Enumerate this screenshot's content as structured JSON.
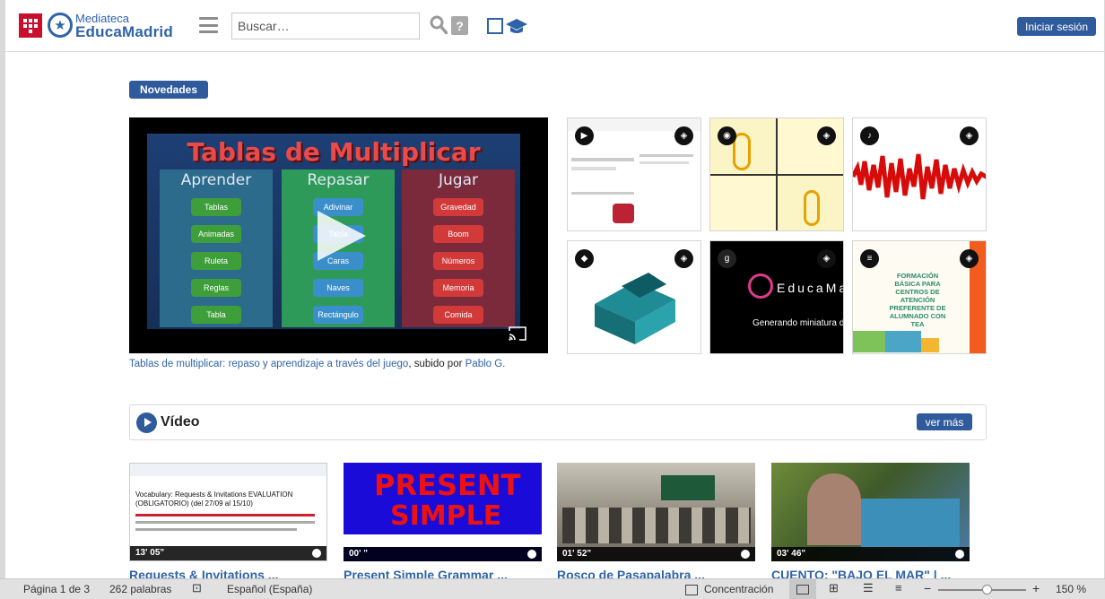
{
  "header": {
    "logo_small": "Mediateca",
    "logo_big": "EducaMadrid",
    "search_placeholder": "Buscar…",
    "help_label": "?",
    "login_label": "Iniciar sesión"
  },
  "novedades": {
    "badge": "Novedades",
    "featured": {
      "board_title": "Tablas de Multiplicar",
      "columns": [
        {
          "header": "Aprender",
          "chips": [
            "Tablas",
            "Animadas",
            "Ruleta",
            "Reglas",
            "Tabla"
          ]
        },
        {
          "header": "Repasar",
          "chips": [
            "Adivinar",
            "Tabla",
            "Caras",
            "Naves",
            "Rectángulo"
          ]
        },
        {
          "header": "Jugar",
          "chips": [
            "Gravedad",
            "Boom",
            "Números",
            "Memoria",
            "Comida"
          ]
        }
      ],
      "caption_link": "Tablas de multiplicar: repaso y aprendizaje a través del juego",
      "caption_mid": ", subido por ",
      "caption_author": "Pablo G."
    },
    "tiles": [
      {
        "type_icon": "play-icon",
        "glyph": "▶"
      },
      {
        "type_icon": "camera-icon",
        "glyph": "◉"
      },
      {
        "type_icon": "audio-icon",
        "glyph": "♪"
      },
      {
        "type_icon": "cube-icon",
        "glyph": "◆"
      },
      {
        "type_icon": "g-icon",
        "glyph": "g",
        "brand_text": "EducaMa",
        "status_text": "Generando miniatura de"
      },
      {
        "type_icon": "document-icon",
        "glyph": "≡",
        "doc_text": "FORMACIÓN BÁSICA PARA CENTROS DE ATENCIÓN PREFERENTE DE ALUMNADO CON TEA"
      }
    ]
  },
  "video_section": {
    "title": "Vídeo",
    "more_label": "ver más",
    "items": [
      {
        "duration": "13' 05\"",
        "title": "Requests & Invitations ..."
      },
      {
        "duration": "00' \"",
        "title": "Present Simple Grammar ..."
      },
      {
        "duration": "01' 52\"",
        "title": "Rosco de Pasapalabra ..."
      },
      {
        "duration": "03' 46\"",
        "title": "CUENTO: \"BAJO EL MAR\" | ..."
      }
    ],
    "thumb_texts": {
      "doc_heading": "Vocabulary: Requests & Invitations EVALUATION (OBLIGATORIO) (del 27/09 al 15/10)",
      "present": "PRESENT",
      "simple": "SIMPLE"
    }
  },
  "statusbar": {
    "page": "Página 1 de 3",
    "words": "262 palabras",
    "language": "Español (España)",
    "focus": "Concentración",
    "zoom": "150 %",
    "zoom_minus": "−",
    "zoom_plus": "+"
  },
  "colors": {
    "brand_blue": "#2f5b9c",
    "link_blue": "#2f63a8",
    "madrid_red": "#c8102e"
  }
}
